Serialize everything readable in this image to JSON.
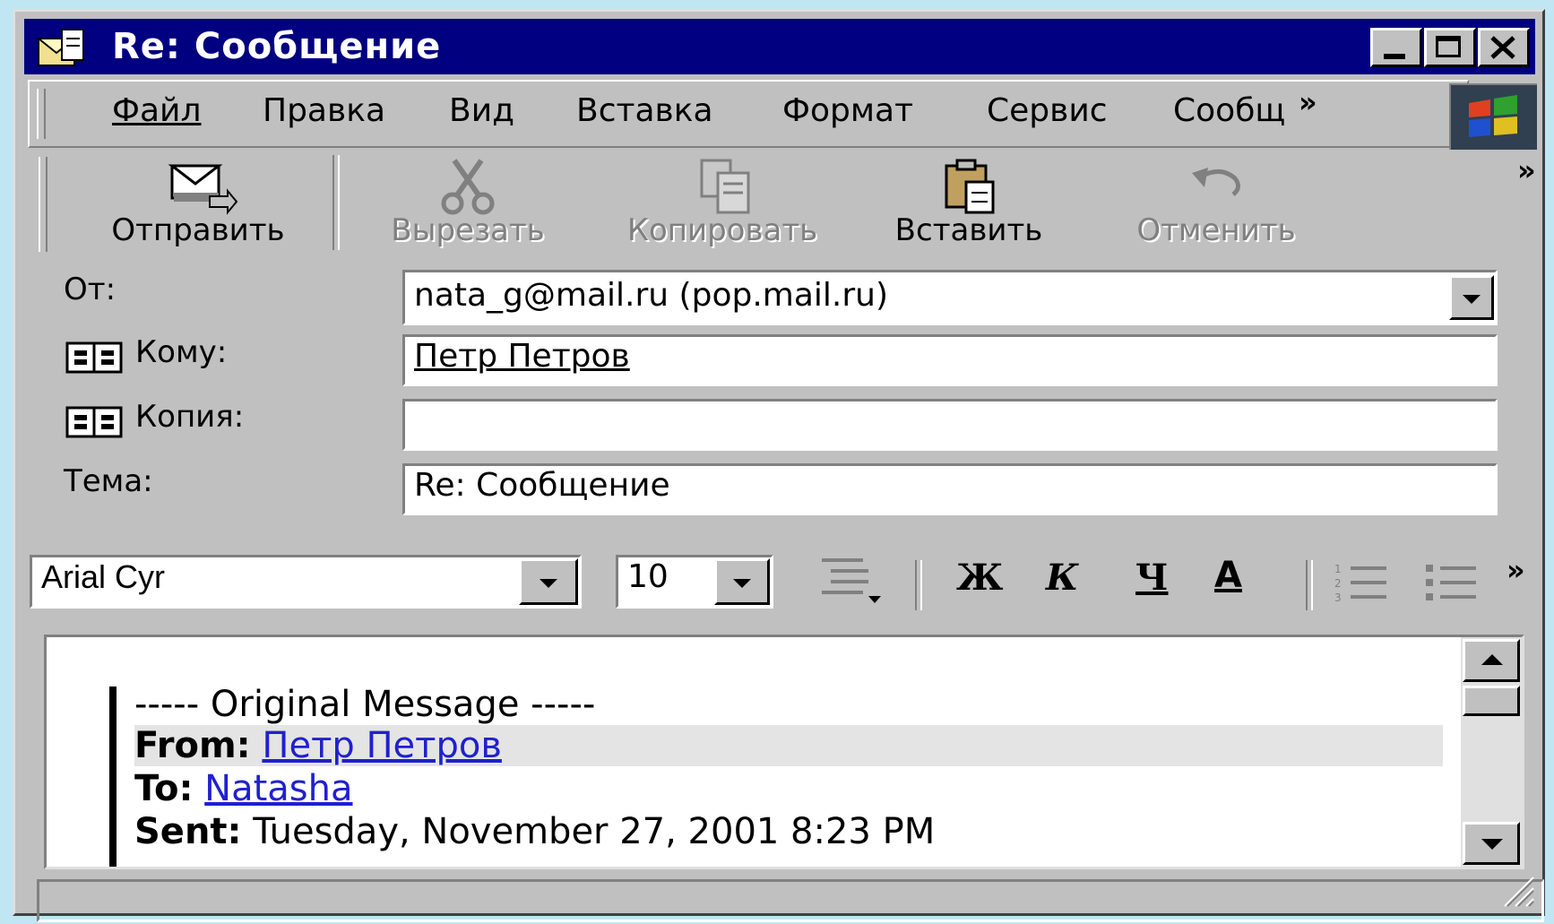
{
  "window": {
    "title": "Re: Сообщение",
    "controls": [
      "minimize-icon",
      "maximize-icon",
      "close-icon"
    ]
  },
  "menu": {
    "items": [
      "Файл",
      "Правка",
      "Вид",
      "Вставка",
      "Формат",
      "Сервис",
      "Сообщ"
    ],
    "overflow": "»"
  },
  "toolbar": {
    "buttons": [
      {
        "label": "Отправить",
        "icon": "send-icon",
        "enabled": true
      },
      {
        "label": "Вырезать",
        "icon": "scissors-icon",
        "enabled": false
      },
      {
        "label": "Копировать",
        "icon": "copy-icon",
        "enabled": false
      },
      {
        "label": "Вставить",
        "icon": "paste-icon",
        "enabled": true
      },
      {
        "label": "Отменить",
        "icon": "undo-icon",
        "enabled": false
      }
    ],
    "overflow": "»"
  },
  "header": {
    "from_label": "От:",
    "from_value": "nata_g@mail.ru     (pop.mail.ru)",
    "to_label": "Кому:",
    "to_value": "Петр Петров",
    "cc_label": "Копия:",
    "cc_value": "",
    "subject_label": "Тема:",
    "subject_value": "Re: Сообщение"
  },
  "format": {
    "font": "Arial Cyr",
    "size": "10",
    "bold": "Ж",
    "italic": "К",
    "underline": "Ч",
    "color": "A",
    "overflow": "»"
  },
  "body": {
    "original_header": "----- Original Message -----",
    "from_key": "From:",
    "from_value": "Петр Петров",
    "to_key": "To:",
    "to_value": "Natasha",
    "sent_key": "Sent:",
    "sent_value": "Tuesday, November 27, 2001 8:23 PM"
  },
  "colors": {
    "titlebar": "#000080",
    "face": "#c0c0c0",
    "link": "#2020d0",
    "desktop": "#bfe6f2"
  }
}
